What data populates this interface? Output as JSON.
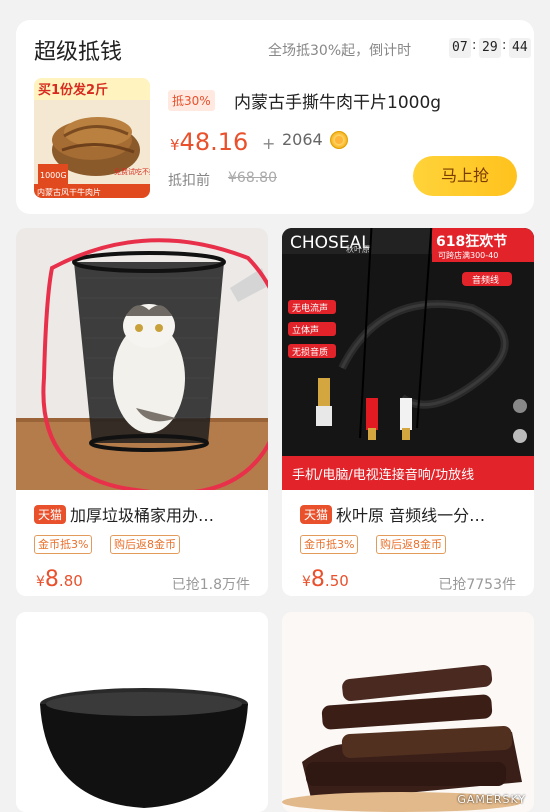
{
  "super_deal": {
    "title": "超级抵钱",
    "subtitle": "全场抵30%起，倒计时",
    "countdown": [
      "07",
      "29",
      "44"
    ],
    "product": {
      "image_text": [
        "买1份发2斤",
        "1000G",
        "内蒙古风干牛肉片",
        "免费试吃不好包退"
      ],
      "discount_tag": "抵30%",
      "title": "内蒙古手撕牛肉干片1000g",
      "price_symbol": "¥",
      "price": "48.16",
      "plus": "+",
      "coins": "2064",
      "original_label": "抵扣前",
      "original_price": "¥68.80",
      "buy_label": "马上抢"
    }
  },
  "grid": [
    {
      "badge": "天猫",
      "title": "加厚垃圾桶家用办…",
      "chips": [
        "金币抵3%",
        "购后返8金币"
      ],
      "price_symbol": "¥",
      "price_int": "8",
      "price_dec": ".80",
      "sold": "已抢1.8万件"
    },
    {
      "badge": "天猫",
      "title": "秋叶原 音频线一分…",
      "chips": [
        "金币抵3%",
        "购后返8金币"
      ],
      "price_symbol": "¥",
      "price_int": "8",
      "price_dec": ".50",
      "sold": "已抢7753件",
      "image_text": {
        "brand": "CHOSEAL",
        "brand_cn": "秋叶原",
        "banner": "618狂欢节",
        "banner_sub": "可跨店满300-40",
        "cable_tag": "音频线",
        "features": [
          "无电流声",
          "立体声",
          "无损音质"
        ],
        "bottom": "手机/电脑/电视连接音响/功放线"
      }
    }
  ],
  "watermark": "GAMERSKY",
  "colors": {
    "accent": "#e9502c",
    "buy_button": "#ffc21d",
    "annotation": "#e8304a"
  }
}
